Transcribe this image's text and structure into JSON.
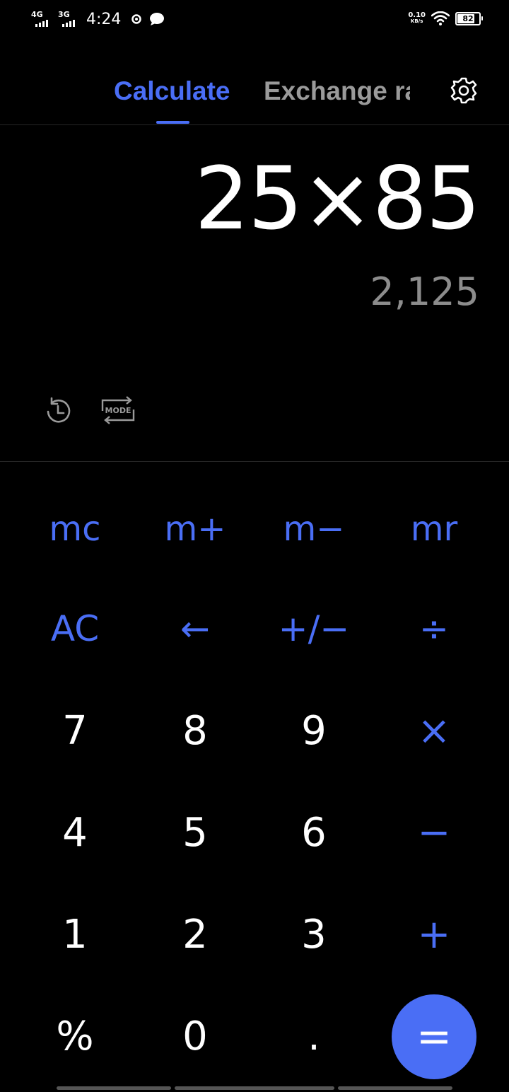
{
  "status_bar": {
    "net1_label": "4G",
    "net2_label": "3G",
    "time": "4:24",
    "speed_value": "0.10",
    "speed_unit": "KB/s",
    "battery": "82",
    "battery_level": 0.82
  },
  "tabs": {
    "calculate": "Calculate",
    "exchange": "Exchange rate"
  },
  "display": {
    "expression": "25×85",
    "result": "2,125"
  },
  "mode_button": {
    "label": "MODE"
  },
  "keypad": {
    "mc": "mc",
    "mplus": "m+",
    "mminus": "m−",
    "mr": "mr",
    "ac": "AC",
    "backspace": "←",
    "plusminus": "+/−",
    "divide": "÷",
    "k7": "7",
    "k8": "8",
    "k9": "9",
    "multiply": "×",
    "k4": "4",
    "k5": "5",
    "k6": "6",
    "minus": "−",
    "k1": "1",
    "k2": "2",
    "k3": "3",
    "plus": "+",
    "percent": "%",
    "k0": "0",
    "dot": ".",
    "equals": "="
  },
  "colors": {
    "accent": "#4a6ef5",
    "background": "#000000",
    "inactive_tab": "#9a9a9a",
    "result_text": "#8c8c8c"
  }
}
